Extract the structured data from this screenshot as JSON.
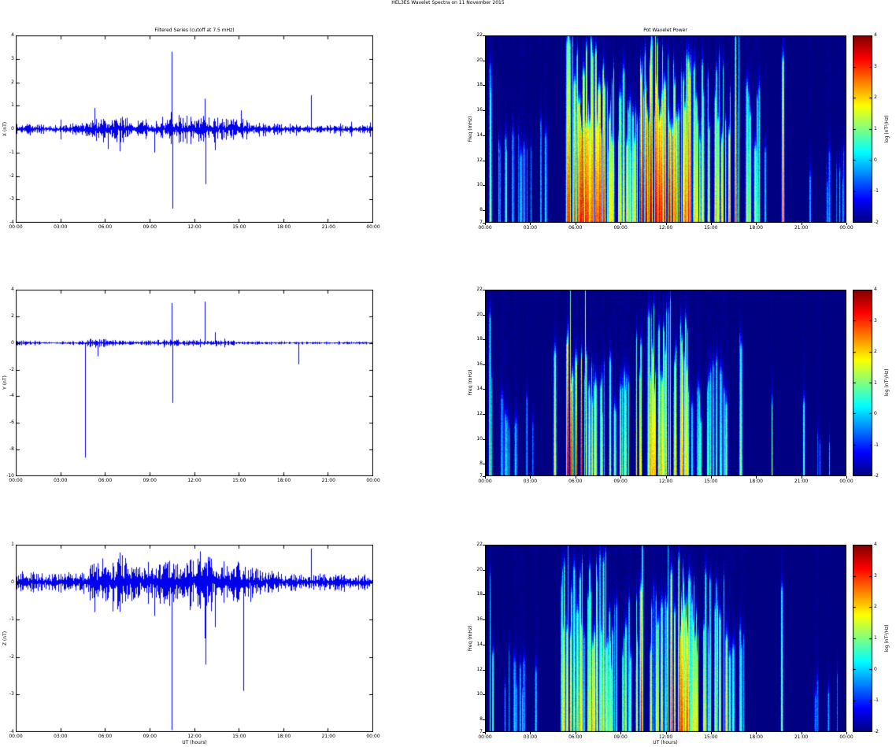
{
  "figure": {
    "title": "HEL3ES Wavelet Spectra on 11 November 2015"
  },
  "colors": {
    "trace": "#0000ee",
    "frame": "#000000",
    "spectrogram_background": "#00007f",
    "colormap": "jet"
  },
  "chart_data": [
    {
      "id": "x-filtered-series",
      "type": "line",
      "title": "Filtered Series (cutoff at 7.5 mHz)",
      "xlabel": "",
      "ylabel": "X (nT)",
      "xlim_hours": [
        0,
        24
      ],
      "ylim": [
        -4,
        4
      ],
      "x_ticks": [
        "00:00",
        "03:00",
        "06:00",
        "09:00",
        "12:00",
        "15:00",
        "18:00",
        "21:00",
        "00:00"
      ],
      "x_tick_hours": [
        0,
        3,
        6,
        9,
        12,
        15,
        18,
        21,
        24
      ],
      "y_ticks": [
        4,
        3,
        2,
        1,
        0,
        -1,
        -2,
        -3,
        -4
      ],
      "noise_envelope_nT": [
        [
          0,
          0.11
        ],
        [
          3,
          0.11
        ],
        [
          4.5,
          0.13
        ],
        [
          5,
          0.3
        ],
        [
          5.5,
          0.24
        ],
        [
          6,
          0.32
        ],
        [
          6.5,
          0.26
        ],
        [
          7,
          0.3
        ],
        [
          7.5,
          0.24
        ],
        [
          8,
          0.2
        ],
        [
          9,
          0.18
        ],
        [
          9.5,
          0.22
        ],
        [
          10,
          0.26
        ],
        [
          10.5,
          0.32
        ],
        [
          11,
          0.28
        ],
        [
          11.5,
          0.26
        ],
        [
          12,
          0.3
        ],
        [
          12.5,
          0.36
        ],
        [
          13,
          0.3
        ],
        [
          13.5,
          0.26
        ],
        [
          14,
          0.24
        ],
        [
          14.5,
          0.3
        ],
        [
          15,
          0.26
        ],
        [
          15.5,
          0.22
        ],
        [
          16,
          0.16
        ],
        [
          17,
          0.13
        ],
        [
          18,
          0.13
        ],
        [
          19,
          0.11
        ],
        [
          20,
          0.11
        ],
        [
          21,
          0.09
        ],
        [
          22,
          0.09
        ],
        [
          23,
          0.09
        ],
        [
          24,
          0.09
        ]
      ],
      "spikes_nT": [
        {
          "t": 10.45,
          "a": 3.3
        },
        {
          "t": 10.5,
          "a": -3.4
        },
        {
          "t": 12.7,
          "a": 1.3
        },
        {
          "t": 12.75,
          "a": -2.35
        },
        {
          "t": 7.0,
          "a": -0.95
        },
        {
          "t": 9.3,
          "a": -1.0
        },
        {
          "t": 19.8,
          "a": 1.45
        },
        {
          "t": 5.3,
          "a": 0.9
        },
        {
          "t": 6.2,
          "a": -0.85
        },
        {
          "t": 13.4,
          "a": -0.9
        },
        {
          "t": 15.1,
          "a": 0.8
        }
      ],
      "seed": 1
    },
    {
      "id": "y-filtered-series",
      "type": "line",
      "title": "",
      "xlabel": "",
      "ylabel": "Y (nT)",
      "xlim_hours": [
        0,
        24
      ],
      "ylim": [
        -10,
        4
      ],
      "x_ticks": [
        "00:00",
        "03:00",
        "06:00",
        "09:00",
        "12:00",
        "15:00",
        "18:00",
        "21:00",
        "00:00"
      ],
      "x_tick_hours": [
        0,
        3,
        6,
        9,
        12,
        15,
        18,
        21,
        24
      ],
      "y_ticks": [
        4,
        2,
        0,
        -2,
        -4,
        -6,
        -8,
        -10
      ],
      "noise_envelope_nT": [
        [
          0,
          0.1
        ],
        [
          1,
          0.08
        ],
        [
          4,
          0.07
        ],
        [
          4.8,
          0.1
        ],
        [
          5,
          0.16
        ],
        [
          5.5,
          0.14
        ],
        [
          6,
          0.17
        ],
        [
          6.5,
          0.13
        ],
        [
          7,
          0.11
        ],
        [
          8,
          0.1
        ],
        [
          9,
          0.1
        ],
        [
          9.8,
          0.13
        ],
        [
          10,
          0.15
        ],
        [
          10.5,
          0.14
        ],
        [
          11,
          0.12
        ],
        [
          11.5,
          0.13
        ],
        [
          12,
          0.15
        ],
        [
          12.5,
          0.14
        ],
        [
          13,
          0.12
        ],
        [
          13.5,
          0.11
        ],
        [
          14,
          0.1
        ],
        [
          15,
          0.08
        ],
        [
          16,
          0.06
        ],
        [
          18,
          0.06
        ],
        [
          20,
          0.05
        ],
        [
          22,
          0.05
        ],
        [
          24,
          0.05
        ]
      ],
      "spikes_nT": [
        {
          "t": 4.65,
          "a": -8.6
        },
        {
          "t": 10.45,
          "a": 3.0
        },
        {
          "t": 10.5,
          "a": -4.5
        },
        {
          "t": 12.7,
          "a": 3.1
        },
        {
          "t": 19.0,
          "a": -1.6
        },
        {
          "t": 5.5,
          "a": -1.0
        },
        {
          "t": 13.4,
          "a": 0.8
        }
      ],
      "seed": 2
    },
    {
      "id": "z-filtered-series",
      "type": "line",
      "title": "",
      "xlabel": "UT (hours)",
      "ylabel": "Z (nT)",
      "xlim_hours": [
        0,
        24
      ],
      "ylim": [
        -4,
        1
      ],
      "x_ticks": [
        "00:00",
        "03:00",
        "06:00",
        "09:00",
        "12:00",
        "15:00",
        "18:00",
        "21:00",
        "00:00"
      ],
      "x_tick_hours": [
        0,
        3,
        6,
        9,
        12,
        15,
        18,
        21,
        24
      ],
      "y_ticks": [
        1,
        0,
        -1,
        -2,
        -3,
        -4
      ],
      "noise_envelope_nT": [
        [
          0,
          0.13
        ],
        [
          3,
          0.13
        ],
        [
          4.5,
          0.16
        ],
        [
          5,
          0.3
        ],
        [
          6,
          0.36
        ],
        [
          6.5,
          0.3
        ],
        [
          7,
          0.36
        ],
        [
          8,
          0.28
        ],
        [
          9,
          0.26
        ],
        [
          10,
          0.3
        ],
        [
          10.5,
          0.36
        ],
        [
          11,
          0.3
        ],
        [
          12,
          0.34
        ],
        [
          12.5,
          0.4
        ],
        [
          13,
          0.34
        ],
        [
          13.5,
          0.3
        ],
        [
          14,
          0.3
        ],
        [
          15,
          0.28
        ],
        [
          15.5,
          0.26
        ],
        [
          16,
          0.2
        ],
        [
          17,
          0.16
        ],
        [
          18,
          0.13
        ],
        [
          19,
          0.13
        ],
        [
          20,
          0.11
        ],
        [
          21,
          0.11
        ],
        [
          22,
          0.11
        ],
        [
          23,
          0.11
        ],
        [
          24,
          0.11
        ]
      ],
      "spikes_nT": [
        {
          "t": 10.45,
          "a": -3.95
        },
        {
          "t": 12.7,
          "a": -1.5
        },
        {
          "t": 12.75,
          "a": -2.2
        },
        {
          "t": 15.3,
          "a": -2.9
        },
        {
          "t": 19.8,
          "a": 0.9
        },
        {
          "t": 5.3,
          "a": -0.8
        },
        {
          "t": 9.3,
          "a": -0.9
        },
        {
          "t": 13.4,
          "a": -1.2
        },
        {
          "t": 7.0,
          "a": 0.7
        }
      ],
      "seed": 3
    },
    {
      "id": "x-wavelet-power",
      "type": "heatmap",
      "title": "Pot Wavelet Power",
      "xlabel": "",
      "ylabel": "Freq (mHz)",
      "xlim_hours": [
        0,
        24
      ],
      "ylim_mhz": [
        7,
        22
      ],
      "x_ticks": [
        "00:00",
        "03:00",
        "06:00",
        "09:00",
        "12:00",
        "15:00",
        "18:00",
        "21:00",
        "00:00"
      ],
      "x_tick_hours": [
        0,
        3,
        6,
        9,
        12,
        15,
        18,
        21,
        24
      ],
      "y_ticks": [
        22,
        20,
        18,
        16,
        14,
        12,
        10,
        8,
        7
      ],
      "power_bands": [
        {
          "start": 0.15,
          "end": 0.55,
          "peak": 2.0,
          "density": 5,
          "height": 0.95
        },
        {
          "start": 0.8,
          "end": 4.6,
          "peak": 0.8,
          "density": 2.5,
          "height": 0.55
        },
        {
          "start": 5.2,
          "end": 8.1,
          "peak": 3.4,
          "density": 9,
          "height": 1.0
        },
        {
          "start": 8.1,
          "end": 10.2,
          "peak": 2.2,
          "density": 7,
          "height": 0.8
        },
        {
          "start": 10.2,
          "end": 13.6,
          "peak": 3.8,
          "density": 9,
          "height": 1.0
        },
        {
          "start": 13.6,
          "end": 16.3,
          "peak": 2.4,
          "density": 7,
          "height": 0.85
        },
        {
          "start": 16.6,
          "end": 17.1,
          "peak": 3.0,
          "density": 4,
          "height": 1.0
        },
        {
          "start": 17.3,
          "end": 18.6,
          "peak": 1.6,
          "density": 4,
          "height": 0.7
        },
        {
          "start": 19.65,
          "end": 19.95,
          "peak": 3.4,
          "density": 3,
          "height": 1.0
        },
        {
          "start": 20.5,
          "end": 23.8,
          "peak": 0.3,
          "density": 1.5,
          "height": 0.4
        }
      ],
      "colorbar": {
        "label": "log (nT²/Hz)",
        "ticks": [
          4,
          3,
          2,
          1,
          0,
          -1,
          -2
        ],
        "lim": [
          -2,
          4
        ]
      },
      "seed": 11
    },
    {
      "id": "y-wavelet-power",
      "type": "heatmap",
      "title": "",
      "xlabel": "",
      "ylabel": "Freq (mHz)",
      "xlim_hours": [
        0,
        24
      ],
      "ylim_mhz": [
        7,
        22
      ],
      "x_ticks": [
        "00:00",
        "03:00",
        "06:00",
        "09:00",
        "12:00",
        "15:00",
        "18:00",
        "21:00",
        "00:00"
      ],
      "x_tick_hours": [
        0,
        3,
        6,
        9,
        12,
        15,
        18,
        21,
        24
      ],
      "y_ticks": [
        22,
        20,
        18,
        16,
        14,
        12,
        10,
        8,
        7
      ],
      "power_bands": [
        {
          "start": 0.3,
          "end": 0.65,
          "peak": 1.8,
          "density": 4,
          "height": 0.95
        },
        {
          "start": 1.0,
          "end": 4.3,
          "peak": 0.4,
          "density": 1.5,
          "height": 0.45
        },
        {
          "start": 4.5,
          "end": 4.8,
          "peak": 2.2,
          "density": 3,
          "height": 0.95
        },
        {
          "start": 5.4,
          "end": 6.7,
          "peak": 3.8,
          "density": 6,
          "height": 1.0
        },
        {
          "start": 6.7,
          "end": 9.6,
          "peak": 1.7,
          "density": 6,
          "height": 0.7
        },
        {
          "start": 10.0,
          "end": 13.6,
          "peak": 2.4,
          "density": 7,
          "height": 0.9
        },
        {
          "start": 13.6,
          "end": 16.0,
          "peak": 1.2,
          "density": 4,
          "height": 0.6
        },
        {
          "start": 16.8,
          "end": 17.3,
          "peak": 1.6,
          "density": 2,
          "height": 0.8
        },
        {
          "start": 18.8,
          "end": 19.2,
          "peak": 1.4,
          "density": 2,
          "height": 0.75
        },
        {
          "start": 20.8,
          "end": 21.2,
          "peak": 1.2,
          "density": 2,
          "height": 0.6
        },
        {
          "start": 21.8,
          "end": 23.5,
          "peak": 0.1,
          "density": 1,
          "height": 0.3
        }
      ],
      "colorbar": {
        "label": "log (nT²/Hz)",
        "ticks": [
          4,
          3,
          2,
          1,
          0,
          -1,
          -2
        ],
        "lim": [
          -2,
          4
        ]
      },
      "seed": 12
    },
    {
      "id": "z-wavelet-power",
      "type": "heatmap",
      "title": "",
      "xlabel": "UT (hours)",
      "ylabel": "Freq (mHz)",
      "xlim_hours": [
        0,
        24
      ],
      "ylim_mhz": [
        7,
        22
      ],
      "x_ticks": [
        "00:00",
        "03:00",
        "06:00",
        "09:00",
        "12:00",
        "15:00",
        "18:00",
        "21:00",
        "00:00"
      ],
      "x_tick_hours": [
        0,
        3,
        6,
        9,
        12,
        15,
        18,
        21,
        24
      ],
      "y_ticks": [
        22,
        20,
        18,
        16,
        14,
        12,
        10,
        8,
        7
      ],
      "power_bands": [
        {
          "start": 0.3,
          "end": 0.65,
          "peak": 1.4,
          "density": 3,
          "height": 0.85
        },
        {
          "start": 1.0,
          "end": 4.6,
          "peak": 0.3,
          "density": 1.5,
          "height": 0.4
        },
        {
          "start": 5.0,
          "end": 8.1,
          "peak": 2.4,
          "density": 7,
          "height": 0.95
        },
        {
          "start": 8.1,
          "end": 10.1,
          "peak": 1.6,
          "density": 5,
          "height": 0.7
        },
        {
          "start": 10.3,
          "end": 10.7,
          "peak": 3.8,
          "density": 3,
          "height": 1.0
        },
        {
          "start": 10.8,
          "end": 12.0,
          "peak": 2.0,
          "density": 5,
          "height": 0.85
        },
        {
          "start": 12.0,
          "end": 13.6,
          "peak": 3.2,
          "density": 8,
          "height": 1.0
        },
        {
          "start": 13.6,
          "end": 16.1,
          "peak": 2.2,
          "density": 6,
          "height": 0.85
        },
        {
          "start": 15.2,
          "end": 15.6,
          "peak": 3.4,
          "density": 2,
          "height": 1.0
        },
        {
          "start": 16.2,
          "end": 17.3,
          "peak": 1.3,
          "density": 3,
          "height": 0.6
        },
        {
          "start": 19.6,
          "end": 19.95,
          "peak": 2.4,
          "density": 2,
          "height": 0.9
        },
        {
          "start": 20.5,
          "end": 23.5,
          "peak": 0.1,
          "density": 1,
          "height": 0.3
        }
      ],
      "colorbar": {
        "label": "log (nT²/Hz)",
        "ticks": [
          4,
          3,
          2,
          1,
          0,
          -1,
          -2
        ],
        "lim": [
          -2,
          4
        ]
      },
      "seed": 13
    }
  ]
}
